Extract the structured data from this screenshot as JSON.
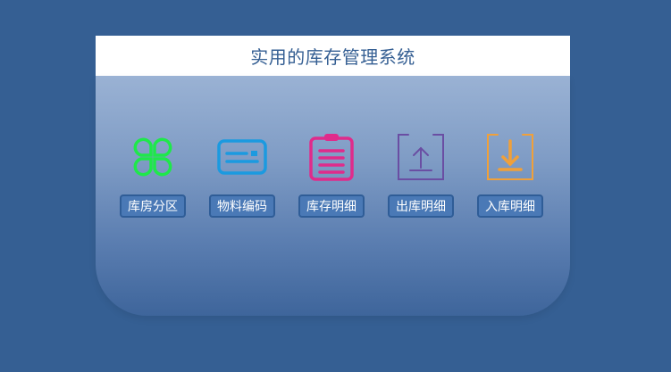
{
  "app": {
    "title": "实用的库存管理系统"
  },
  "modules": [
    {
      "label": "库房分区",
      "icon": "clover-icon",
      "color": "#1ee84a"
    },
    {
      "label": "物料编码",
      "icon": "card-icon",
      "color": "#1b9ae0"
    },
    {
      "label": "库存明细",
      "icon": "clipboard-icon",
      "color": "#e02b8b"
    },
    {
      "label": "出库明细",
      "icon": "upload-icon",
      "color": "#6a4ea3"
    },
    {
      "label": "入库明细",
      "icon": "download-icon",
      "color": "#f0a03a"
    }
  ]
}
